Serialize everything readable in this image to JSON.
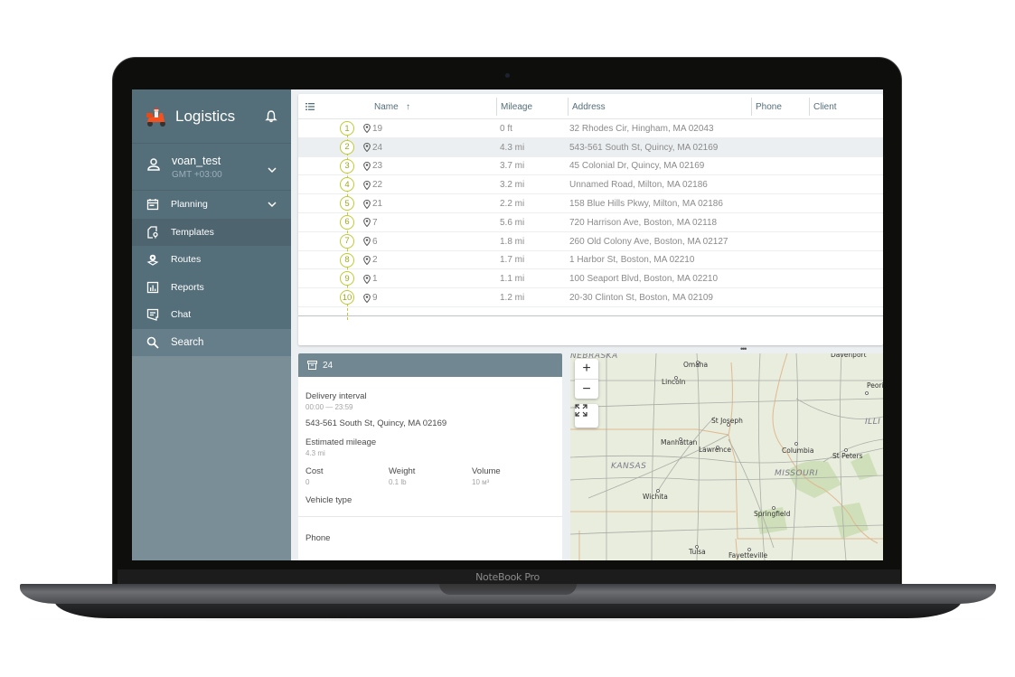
{
  "device": {
    "brand_label": "NoteBook Pro"
  },
  "sidebar": {
    "app_title": "Logistics",
    "user": {
      "name": "voan_test",
      "timezone": "GMT +03:00"
    },
    "items": [
      {
        "label": "Planning",
        "icon": "calendar-icon",
        "expandable": true
      },
      {
        "label": "Templates",
        "icon": "template-icon",
        "active": true
      },
      {
        "label": "Routes",
        "icon": "route-pin-icon"
      },
      {
        "label": "Reports",
        "icon": "bar-chart-icon"
      },
      {
        "label": "Chat",
        "icon": "chat-icon"
      },
      {
        "label": "Search",
        "icon": "search-icon"
      }
    ]
  },
  "table": {
    "columns": [
      "Name",
      "Mileage",
      "Address",
      "Phone",
      "Client"
    ],
    "sort_indicator": "↑",
    "rows": [
      {
        "seq": "1",
        "name": "19",
        "mileage": "0 ft",
        "address": "32 Rhodes Cir, Hingham, MA 02043",
        "phone": "",
        "client": ""
      },
      {
        "seq": "2",
        "name": "24",
        "mileage": "4.3 mi",
        "address": "543-561 South St, Quincy, MA 02169",
        "phone": "",
        "client": "",
        "selected": true
      },
      {
        "seq": "3",
        "name": "23",
        "mileage": "3.7 mi",
        "address": "45 Colonial Dr, Quincy, MA 02169",
        "phone": "",
        "client": ""
      },
      {
        "seq": "4",
        "name": "22",
        "mileage": "3.2 mi",
        "address": "Unnamed Road, Milton, MA 02186",
        "phone": "",
        "client": ""
      },
      {
        "seq": "5",
        "name": "21",
        "mileage": "2.2 mi",
        "address": "158 Blue Hills Pkwy, Milton, MA 02186",
        "phone": "",
        "client": ""
      },
      {
        "seq": "6",
        "name": "7",
        "mileage": "5.6 mi",
        "address": "720 Harrison Ave, Boston, MA 02118",
        "phone": "",
        "client": ""
      },
      {
        "seq": "7",
        "name": "6",
        "mileage": "1.8 mi",
        "address": "260 Old Colony Ave, Boston, MA 02127",
        "phone": "",
        "client": ""
      },
      {
        "seq": "8",
        "name": "2",
        "mileage": "1.7 mi",
        "address": "1 Harbor St, Boston, MA 02210",
        "phone": "",
        "client": ""
      },
      {
        "seq": "9",
        "name": "1",
        "mileage": "1.1 mi",
        "address": "100 Seaport Blvd, Boston, MA 02210",
        "phone": "",
        "client": ""
      },
      {
        "seq": "10",
        "name": "9",
        "mileage": "1.2 mi",
        "address": "20-30 Clinton St, Boston, MA 02109",
        "phone": "",
        "client": ""
      }
    ]
  },
  "detail": {
    "title": "24",
    "delivery_interval_label": "Delivery interval",
    "delivery_interval": "00:00 — 23:59",
    "address": "543-561 South St, Quincy, MA 02169",
    "mileage_label": "Estimated mileage",
    "mileage": "4.3 mi",
    "cost_label": "Cost",
    "cost": "0",
    "weight_label": "Weight",
    "weight": "0.1 lb",
    "volume_label": "Volume",
    "volume": "10 м³",
    "vehicle_type_label": "Vehicle type",
    "phone_label": "Phone"
  },
  "map": {
    "zoom_in": "+",
    "zoom_out": "−",
    "states": [
      "NEBRASKA",
      "KANSAS",
      "MISSOURI",
      "ILLI"
    ],
    "cities": [
      "Omaha",
      "Lincoln",
      "St Joseph",
      "Manhattan",
      "Lawrence",
      "Columbia",
      "St Peters",
      "Wichita",
      "Springfield",
      "Tulsa",
      "Fayetteville",
      "Davenport",
      "Peori"
    ]
  },
  "colors": {
    "sidebar": "#546e7a",
    "accent_badge": "#c0ca33",
    "detail_header": "#718792"
  }
}
